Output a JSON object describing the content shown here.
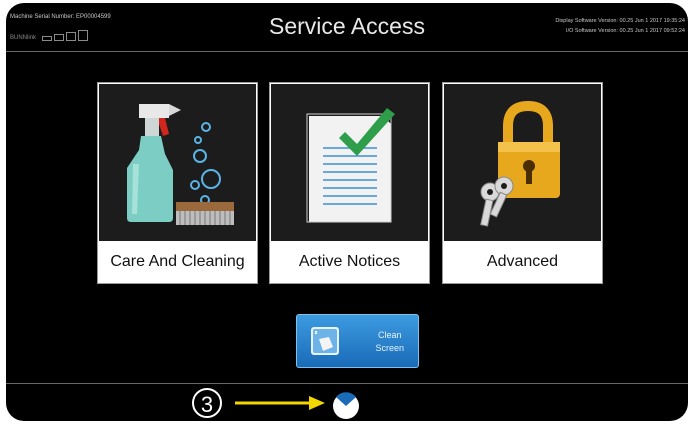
{
  "header": {
    "serial_number": "Machine Serial Number: EP00004599",
    "bunnlink": "BUNNlink",
    "title": "Service Access",
    "display_version": "Display Software Version: 00.25 Jun  1 2017 19:35:24",
    "io_version": "I/O Software Version: 00.25 Jun  1 2017 09:52:24"
  },
  "tiles": [
    {
      "label": "Care And Cleaning",
      "icon": "spray-bottle-brush-icon"
    },
    {
      "label": "Active Notices",
      "icon": "checklist-icon"
    },
    {
      "label": "Advanced",
      "icon": "padlock-keys-icon"
    }
  ],
  "clean_screen": {
    "line1": "Clean",
    "line2": "Screen"
  },
  "annotation": {
    "number": "3"
  },
  "colors": {
    "accent_blue": "#1a6bb8",
    "check_green": "#2e9e4a",
    "lock_gold": "#e8a81e",
    "arrow_yellow": "#f2d600"
  }
}
